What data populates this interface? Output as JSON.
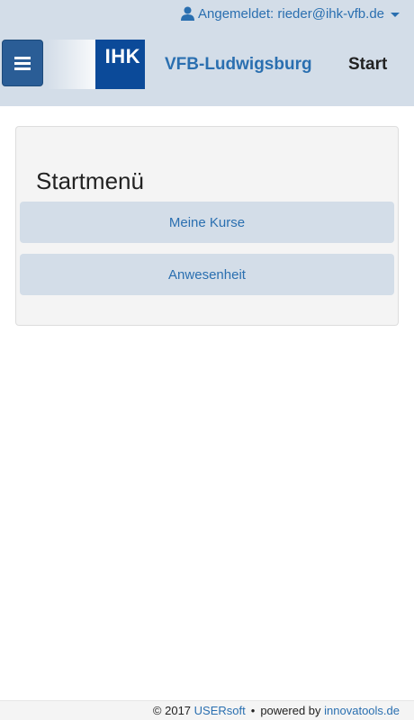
{
  "header": {
    "user_label": "Angemeldet: rieder@ihk-vfb.de",
    "logo_text": "IHK",
    "brand": "VFB-Ludwigsburg",
    "nav_start": "Start"
  },
  "panel": {
    "title": "Startmenü",
    "buttons": [
      {
        "label": "Meine Kurse"
      },
      {
        "label": "Anwesenheit"
      }
    ]
  },
  "footer": {
    "copyright": "© 2017",
    "company": "USERsoft",
    "separator": "•",
    "powered_by": "powered by",
    "powered_link": "innovatools.de"
  },
  "colors": {
    "header_bg": "#d3dde8",
    "accent": "#2a6fb0",
    "toggle_bg": "#2a5d96",
    "logo_blue": "#0b4a99",
    "panel_bg": "#f4f4f4"
  },
  "icons": {
    "user": "user-icon",
    "caret": "caret-down-icon",
    "menu": "hamburger-menu-icon"
  }
}
